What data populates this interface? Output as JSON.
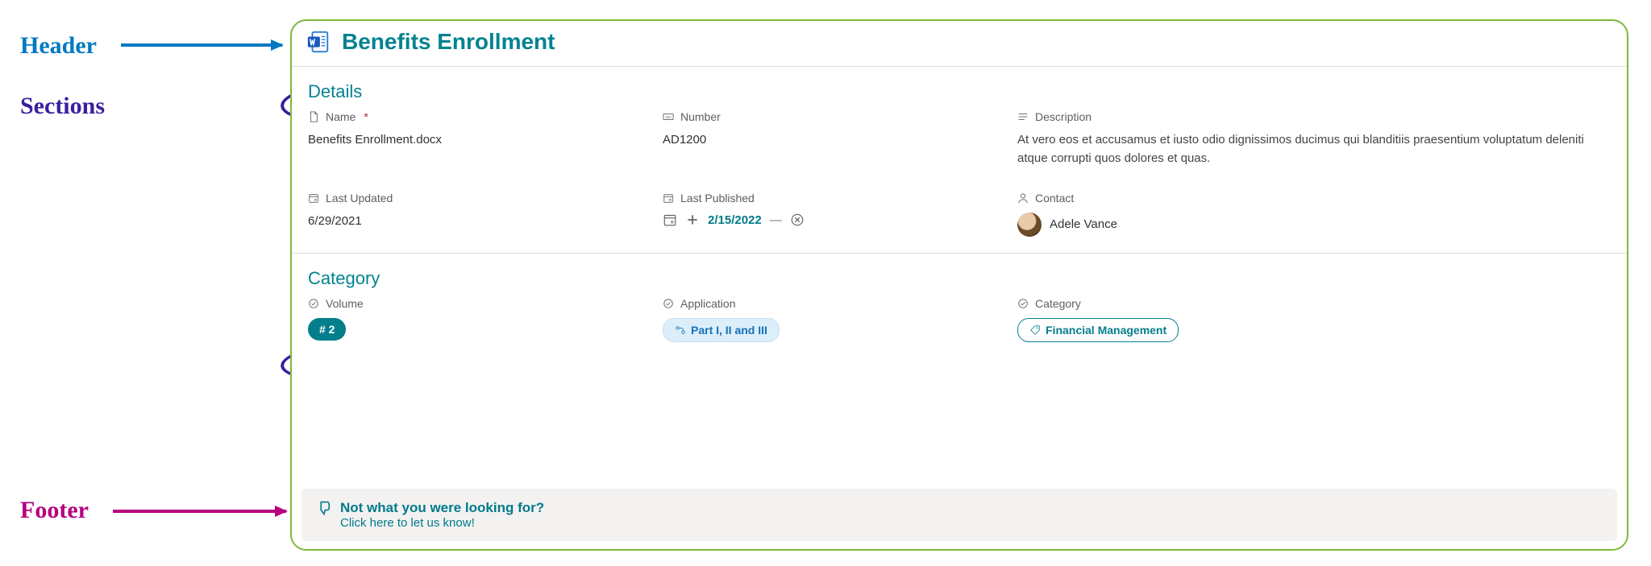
{
  "annotations": {
    "header": "Header",
    "sections": "Sections",
    "footer": "Footer"
  },
  "header": {
    "title": "Benefits Enrollment",
    "icon": "word-doc-icon"
  },
  "sections": {
    "details": {
      "heading": "Details",
      "fields": {
        "name": {
          "label": "Name",
          "required": true,
          "value": "Benefits Enrollment.docx",
          "icon": "file-icon"
        },
        "number": {
          "label": "Number",
          "value": "AD1200",
          "icon": "abc-icon"
        },
        "description": {
          "label": "Description",
          "value": "At vero eos et accusamus et iusto odio dignissimos ducimus qui blanditiis praesentium voluptatum deleniti atque corrupti quos dolores et quas.",
          "icon": "lines-icon"
        },
        "lastUpdated": {
          "label": "Last Updated",
          "value": "6/29/2021",
          "icon": "calendar-icon"
        },
        "lastPublished": {
          "label": "Last Published",
          "value": "2/15/2022",
          "icon": "calendar-icon"
        },
        "contact": {
          "label": "Contact",
          "value": "Adele Vance",
          "icon": "person-icon"
        }
      }
    },
    "category": {
      "heading": "Category",
      "fields": {
        "volume": {
          "label": "Volume",
          "badge": "# 2",
          "icon": "check-circle-icon"
        },
        "application": {
          "label": "Application",
          "badge": "Part I, II and III",
          "icon": "check-circle-icon",
          "badgeIcon": "flow-icon"
        },
        "categoryTag": {
          "label": "Category",
          "badge": "Financial Management",
          "icon": "check-circle-icon",
          "badgeIcon": "tag-icon"
        }
      }
    }
  },
  "footer": {
    "line1": "Not what you were looking for?",
    "line2": "Click here to let us know!",
    "icon": "thumbs-down-icon"
  }
}
